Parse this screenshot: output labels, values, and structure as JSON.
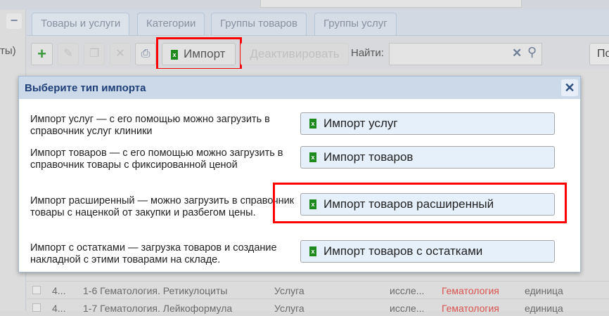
{
  "left_panel": {
    "collapse_label": "−",
    "partial_text": "ты)"
  },
  "tabs": [
    {
      "label": "Товары и услуги"
    },
    {
      "label": "Категории"
    },
    {
      "label": "Группы товаров"
    },
    {
      "label": "Группы услуг"
    }
  ],
  "toolbar": {
    "import_label": "Импорт",
    "deactivate_label": "Деактивировать",
    "find_label": "Найти:",
    "search_value": "",
    "right_button_partial": "По"
  },
  "rows": [
    {
      "id": "4...",
      "name": "1-6 Гематология. Ретикулоциты",
      "type": "Услуга",
      "kind": "иссле...",
      "category": "Гематология",
      "unit": "единица"
    },
    {
      "id": "4...",
      "name": "1-7 Гематология. Лейкоформула",
      "type": "Услуга",
      "kind": "иссле...",
      "category": "Гематология",
      "unit": "единица"
    }
  ],
  "dialog": {
    "title": "Выберите тип импорта",
    "close_label": "✕",
    "options": [
      {
        "desc": "Импорт услуг — с его помощью можно загрузить в справочник услуг клиники",
        "button": "Импорт услуг"
      },
      {
        "desc": "Импорт товаров — с его помощью можно загрузить в справочник товары с фиксированной ценой",
        "button": "Импорт товаров"
      },
      {
        "desc": "Импорт расширенный — можно загрузить в справочник товары с наценкой от закупки и разбегом цены.",
        "button": "Импорт товаров расширенный"
      },
      {
        "desc": "Импорт с остатками — загрузка товаров и создание накладной с этими товарами на складе.",
        "button": "Импорт товаров с остатками"
      }
    ]
  },
  "colors": {
    "highlight": "#ff0000",
    "category_text": "#d9534f",
    "dialog_title": "#1e3e78",
    "excel_green": "#1e8a1e"
  }
}
